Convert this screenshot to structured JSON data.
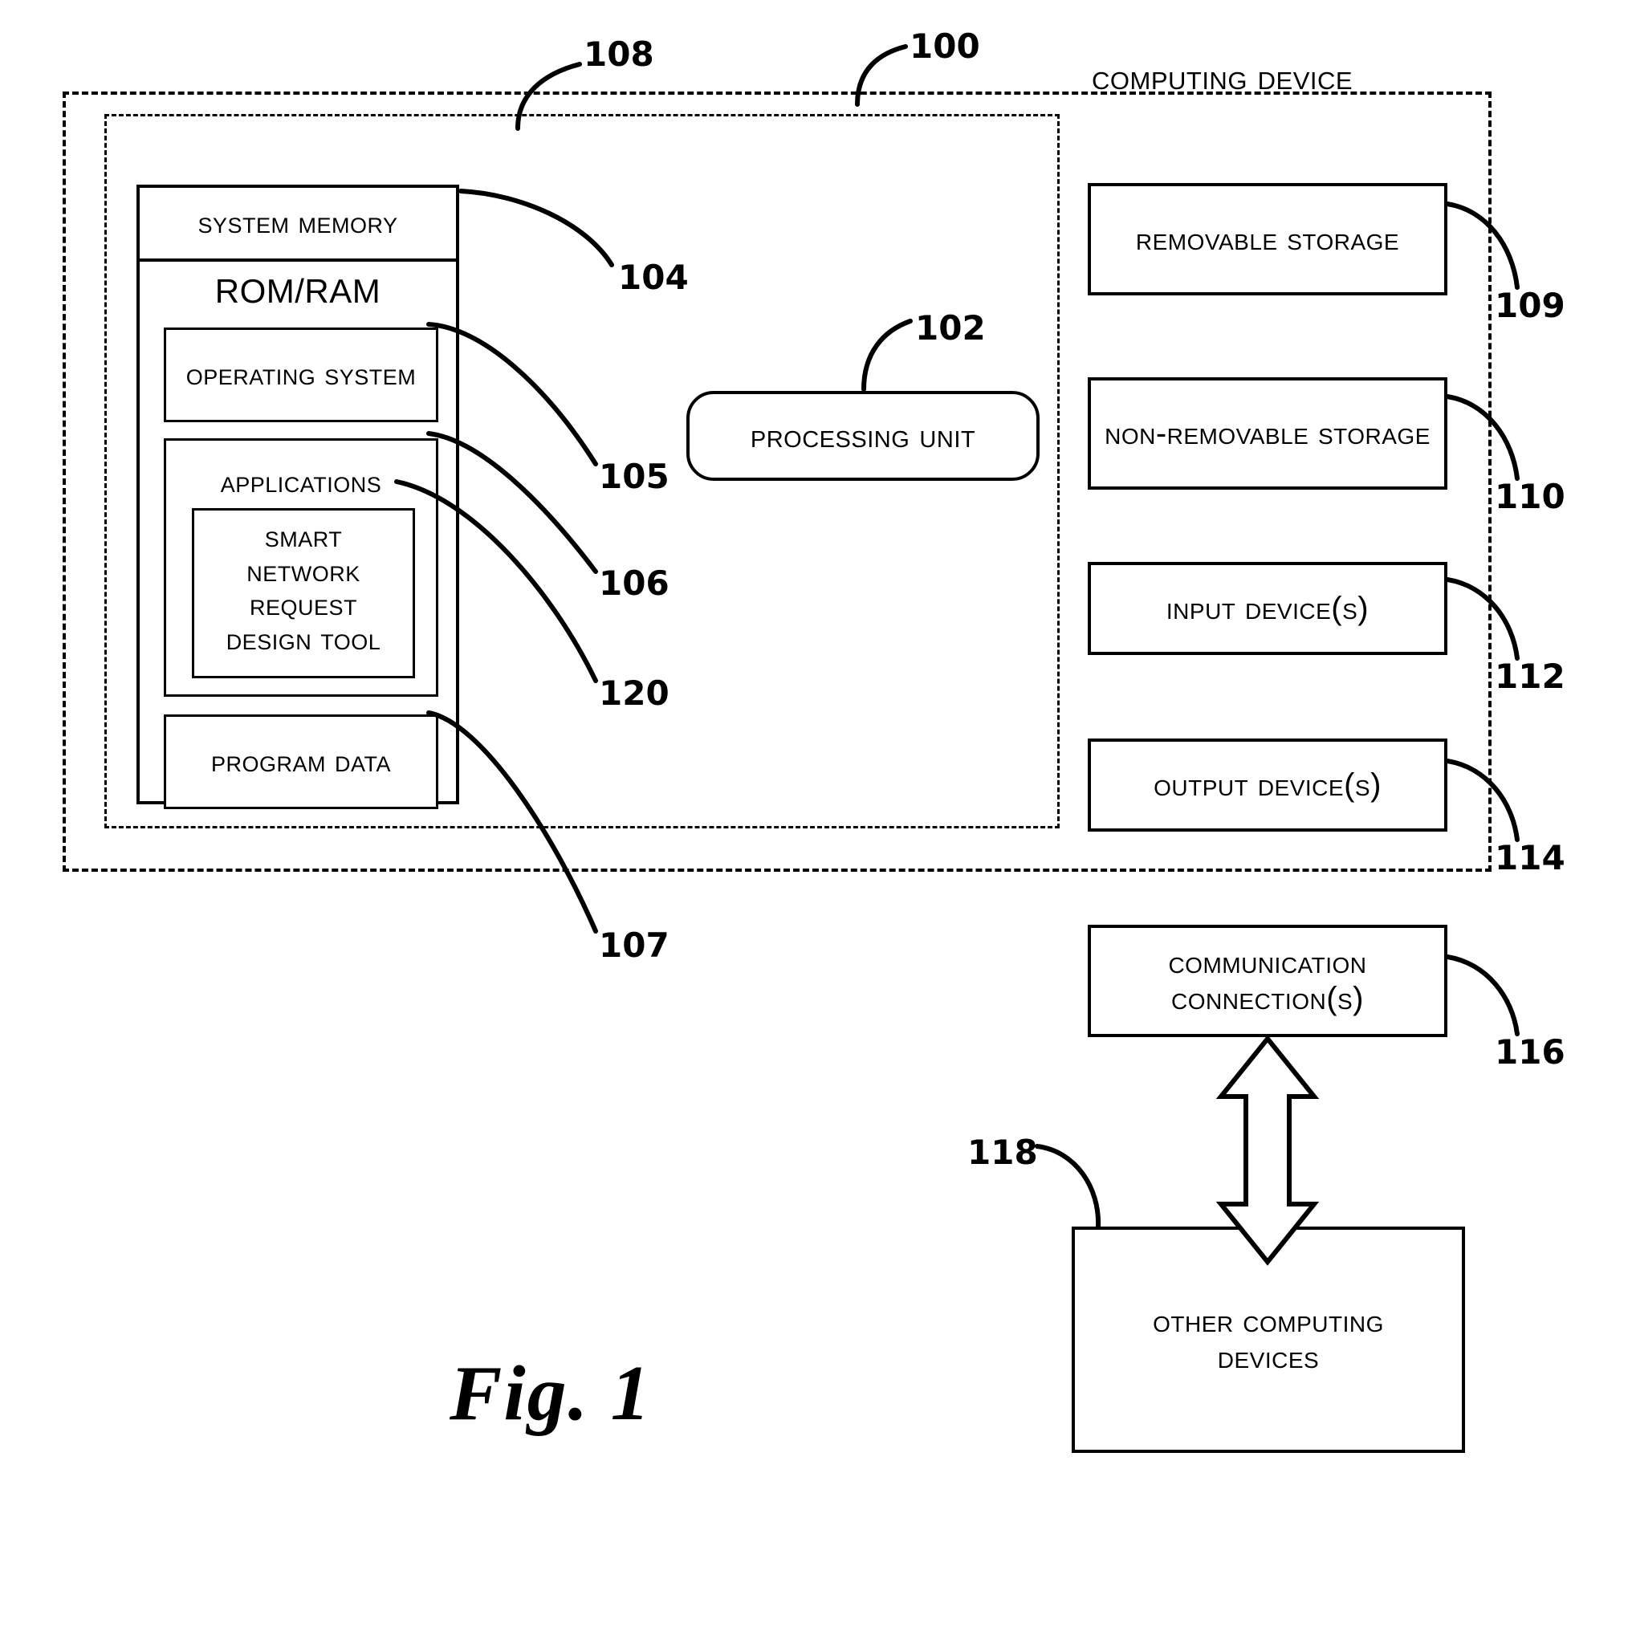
{
  "figure": {
    "caption": "Fig. 1",
    "title": "Computing Device",
    "title_ref": "100"
  },
  "refs": {
    "r100": "100",
    "r102": "102",
    "r104": "104",
    "r105": "105",
    "r106": "106",
    "r107": "107",
    "r108": "108",
    "r109": "109",
    "r110": "110",
    "r112": "112",
    "r114": "114",
    "r116": "116",
    "r118": "118",
    "r120": "120"
  },
  "memory": {
    "header": "System Memory",
    "rom_ram": "ROM/RAM",
    "operating_system": "Operating System",
    "applications": "Applications",
    "tool_lines": [
      "Smart",
      "Network",
      "Request",
      "Design Tool"
    ],
    "program_data": "Program Data"
  },
  "processing": {
    "label": "Processing Unit"
  },
  "peripherals": [
    {
      "label": "Removable Storage",
      "ref": "109"
    },
    {
      "label": "Non-Removable Storage",
      "ref": "110"
    },
    {
      "label": "Input Device(s)",
      "ref": "112"
    },
    {
      "label": "Output Device(s)",
      "ref": "114"
    },
    {
      "label": "Communication Connection(s)",
      "ref": "116"
    }
  ],
  "external": {
    "label": "Other Computing Devices",
    "ref": "118"
  }
}
